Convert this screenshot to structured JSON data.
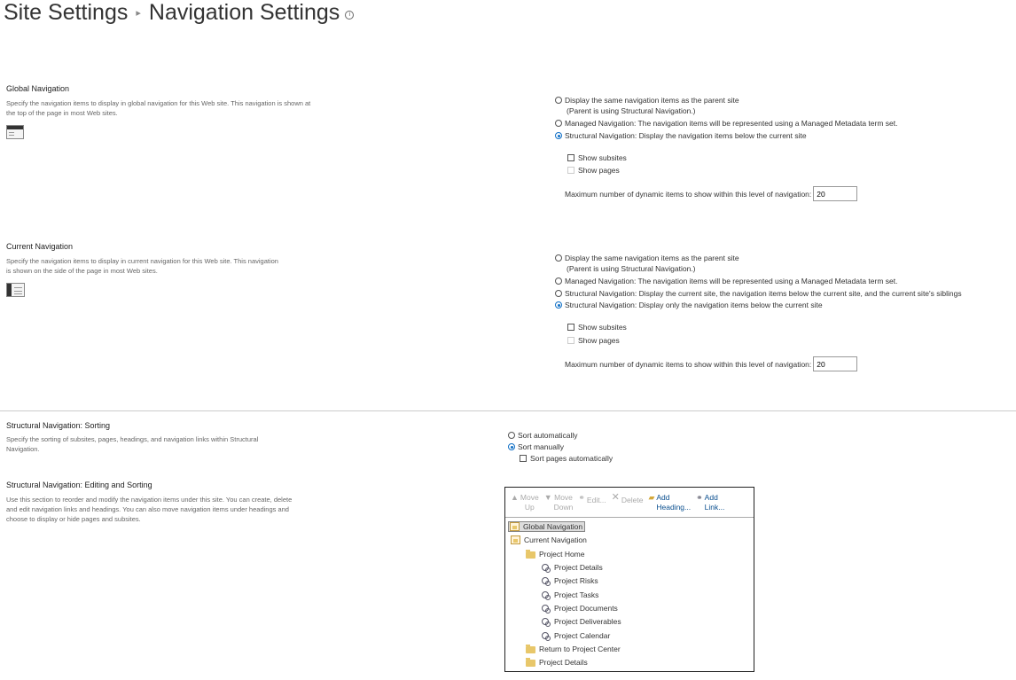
{
  "header": {
    "breadcrumb_root": "Site Settings",
    "separator": "▸",
    "title": "Navigation Settings"
  },
  "global_nav": {
    "title": "Global Navigation",
    "description": "Specify the navigation items to display in global navigation for this Web site. This navigation is shown at the top of the page in most Web sites.",
    "options": [
      {
        "label": "Display the same navigation items as the parent site",
        "sub": "(Parent is using Structural Navigation.)",
        "checked": false
      },
      {
        "label": "Managed Navigation: The navigation items will be represented using a Managed Metadata term set.",
        "checked": false
      },
      {
        "label": "Structural Navigation: Display the navigation items below the current site",
        "checked": true
      }
    ],
    "show_subsites": "Show subsites",
    "show_pages": "Show pages",
    "max_label": "Maximum number of dynamic items to show within this level of navigation:",
    "max_value": "20"
  },
  "current_nav": {
    "title": "Current Navigation",
    "description": "Specify the navigation items to display in current navigation for this Web site. This navigation is shown on the side of the page in most Web sites.",
    "options": [
      {
        "label": "Display the same navigation items as the parent site",
        "sub": "(Parent is using Structural Navigation.)",
        "checked": false
      },
      {
        "label": "Managed Navigation: The navigation items will be represented using a Managed Metadata term set.",
        "checked": false
      },
      {
        "label": "Structural Navigation: Display the current site, the navigation items below the current site, and the current site's siblings",
        "checked": false
      },
      {
        "label": "Structural Navigation: Display only the navigation items below the current site",
        "checked": true
      }
    ],
    "show_subsites": "Show subsites",
    "show_pages": "Show pages",
    "max_label": "Maximum number of dynamic items to show within this level of navigation:",
    "max_value": "20"
  },
  "sorting": {
    "title": "Structural Navigation: Sorting",
    "description": "Specify the sorting of subsites, pages, headings, and navigation links within Structural Navigation.",
    "sort_auto": "Sort automatically",
    "sort_manual": "Sort manually",
    "sort_pages_auto": "Sort pages automatically"
  },
  "editing": {
    "title": "Structural Navigation: Editing and Sorting",
    "description": "Use this section to reorder and modify the navigation items under this site. You can create, delete and edit navigation links and headings. You can also move navigation items under headings and choose to display or hide pages and subsites.",
    "toolbar": {
      "move_up": [
        "Move",
        "Up"
      ],
      "move_down": [
        "Move",
        "Down"
      ],
      "edit": "Edit...",
      "delete": "Delete",
      "add_heading": [
        "Add",
        "Heading..."
      ],
      "add_link": [
        "Add",
        "Link..."
      ]
    },
    "tree": {
      "global": "Global Navigation",
      "current": "Current Navigation",
      "project_home": "Project Home",
      "links": [
        "Project Details",
        "Project Risks",
        "Project Tasks",
        "Project Documents",
        "Project Deliverables",
        "Project Calendar"
      ],
      "return": "Return to Project Center",
      "project_details": "Project Details"
    }
  }
}
